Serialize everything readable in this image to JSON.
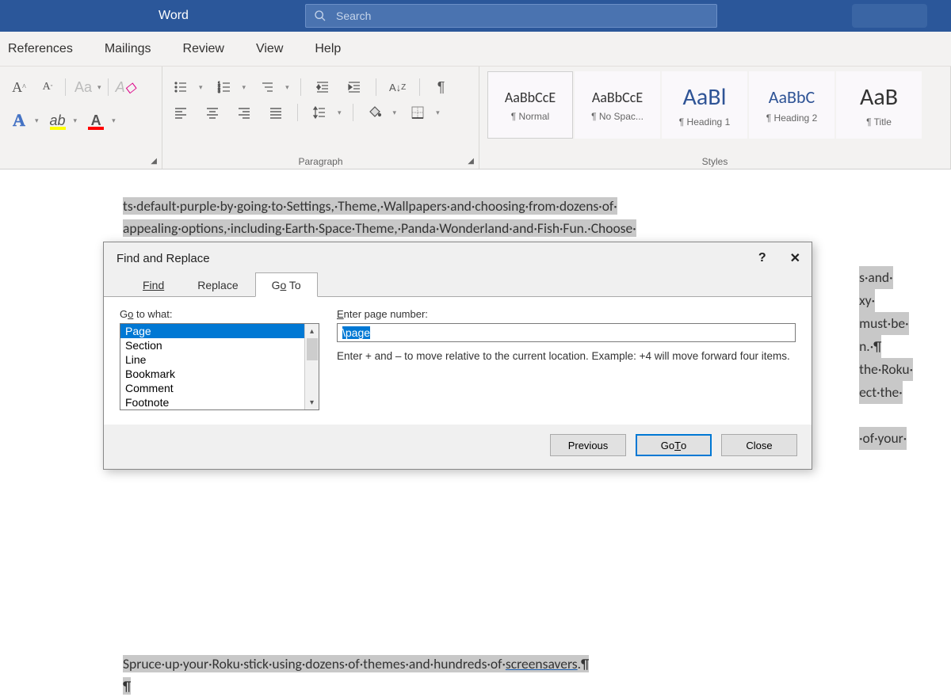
{
  "titlebar": {
    "app": "Word",
    "search_placeholder": "Search"
  },
  "ribbon_tabs": [
    "References",
    "Mailings",
    "Review",
    "View",
    "Help"
  ],
  "group_labels": {
    "paragraph": "Paragraph",
    "styles": "Styles"
  },
  "styles": [
    {
      "preview": "AaBbCcE",
      "name": "¶ Normal",
      "size": "18px",
      "color": "#333"
    },
    {
      "preview": "AaBbCcE",
      "name": "¶ No Spac...",
      "size": "18px",
      "color": "#333"
    },
    {
      "preview": "AaBl",
      "name": "¶ Heading 1",
      "size": "30px",
      "color": "#2F5496"
    },
    {
      "preview": "AaBbC",
      "name": "¶ Heading 2",
      "size": "22px",
      "color": "#2F5496"
    },
    {
      "preview": "AaB",
      "name": "¶ Title",
      "size": "30px",
      "color": "#333"
    }
  ],
  "doc": {
    "line1": "ts·default·purple·by·going·to·Settings,·Theme,·Wallpapers·and·choosing·from·dozens·of·",
    "line2": "appealing·options,·including·Earth·Space·Theme,·Panda·Wonderland·and·Fish·Fun.·Choose·",
    "right": [
      "s·and·",
      "xy·",
      "must·be·",
      "n.·¶",
      "the·Roku·",
      "ect·the·",
      "",
      "·of·your·"
    ],
    "bottom1a": "Spruce·up·your·Roku·stick·using·dozens·of·themes·and·hundreds·of·",
    "bottom1b": "screensavers",
    "bottom1c": ".¶",
    "bottom2": "¶"
  },
  "dialog": {
    "title": "Find and Replace",
    "tabs": {
      "find": "Find",
      "replace": "Replace",
      "goto_pre": "G",
      "goto_ul": "o",
      "goto_post": " To"
    },
    "goto_label_pre": "G",
    "goto_label_ul": "o",
    "goto_label_post": " to what:",
    "list": [
      "Page",
      "Section",
      "Line",
      "Bookmark",
      "Comment",
      "Footnote"
    ],
    "page_label_ul": "E",
    "page_label_post": "nter page number:",
    "page_value": "\\page",
    "hint": "Enter + and – to move relative to the current location. Example: +4 will move forward four items.",
    "buttons": {
      "prev": "Previous",
      "goto_pre": "Go ",
      "goto_ul": "T",
      "goto_post": "o",
      "close": "Close"
    }
  }
}
